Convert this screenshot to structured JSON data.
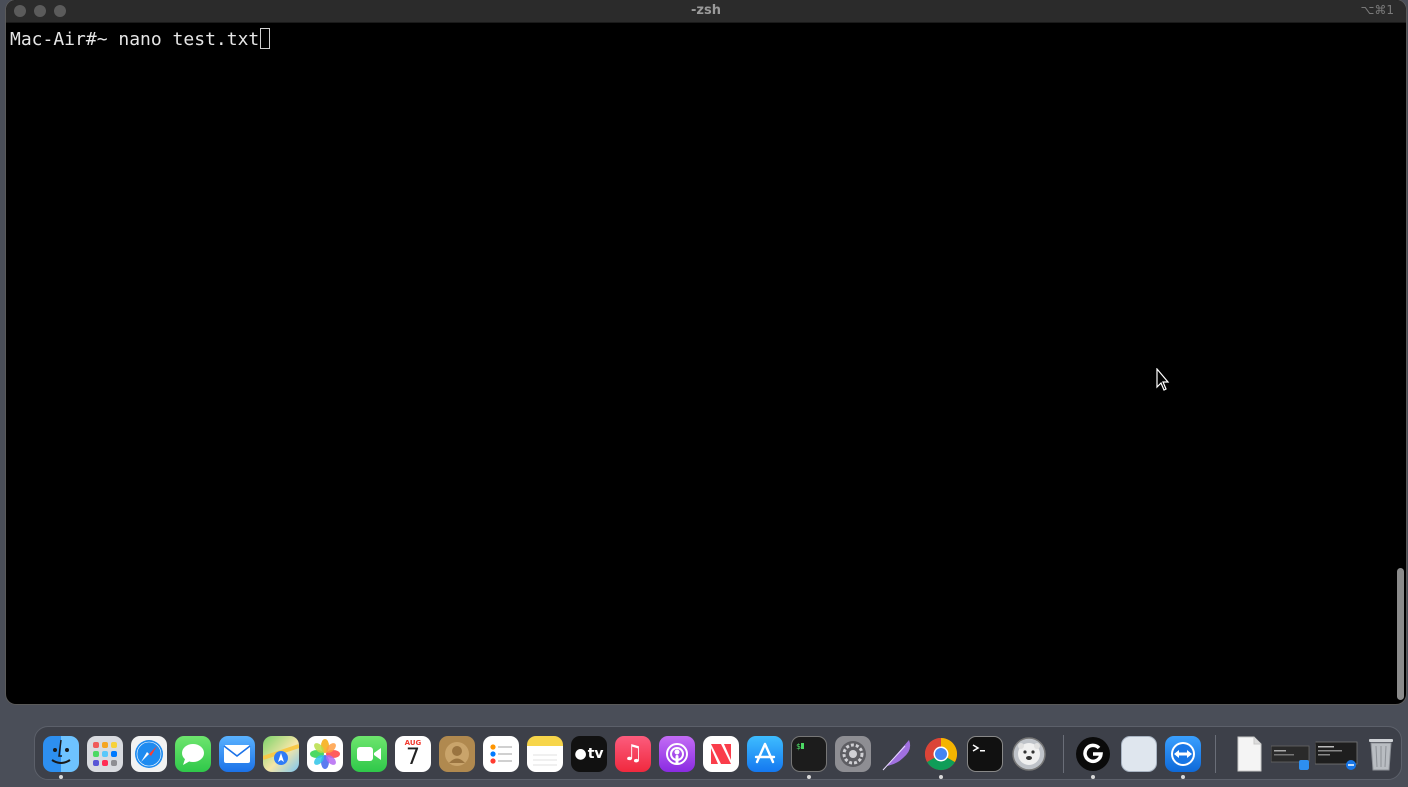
{
  "window": {
    "title": "-zsh",
    "shortcut": "⌥⌘1"
  },
  "terminal": {
    "prompt": "Mac-Air#~ ",
    "command": "nano test.txt"
  },
  "calendar": {
    "month": "AUG",
    "day": "7"
  },
  "dock": {
    "apple_tv_label": "tv"
  }
}
